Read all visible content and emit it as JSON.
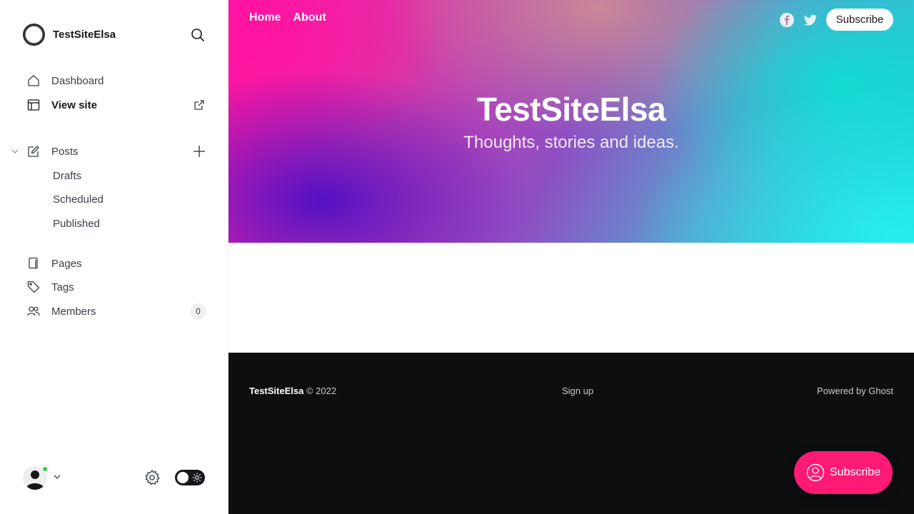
{
  "sidebar": {
    "site_name": "TestSiteElsa",
    "nav": {
      "dashboard": "Dashboard",
      "view_site": "View site",
      "posts": "Posts",
      "drafts": "Drafts",
      "scheduled": "Scheduled",
      "published": "Published",
      "pages": "Pages",
      "tags": "Tags",
      "members": "Members",
      "members_count": "0"
    },
    "icons": [
      "search-icon",
      "home-icon",
      "layout-icon",
      "external-link-icon",
      "chevron-down-icon",
      "edit-icon",
      "plus-icon",
      "page-icon",
      "tag-icon",
      "members-icon",
      "user-icon",
      "gear-icon",
      "sun-icon"
    ],
    "status_color": "#30cf43"
  },
  "site": {
    "nav": {
      "home": "Home",
      "about": "About"
    },
    "subscribe_top": "Subscribe",
    "hero": {
      "title": "TestSiteElsa",
      "subtitle": "Thoughts, stories and ideas."
    },
    "footer": {
      "site_name": "TestSiteElsa",
      "copyright": "© 2022",
      "signup": "Sign up",
      "powered": "Powered by Ghost"
    },
    "subscribe_float": "Subscribe",
    "accent_color": "#ff1a75"
  }
}
